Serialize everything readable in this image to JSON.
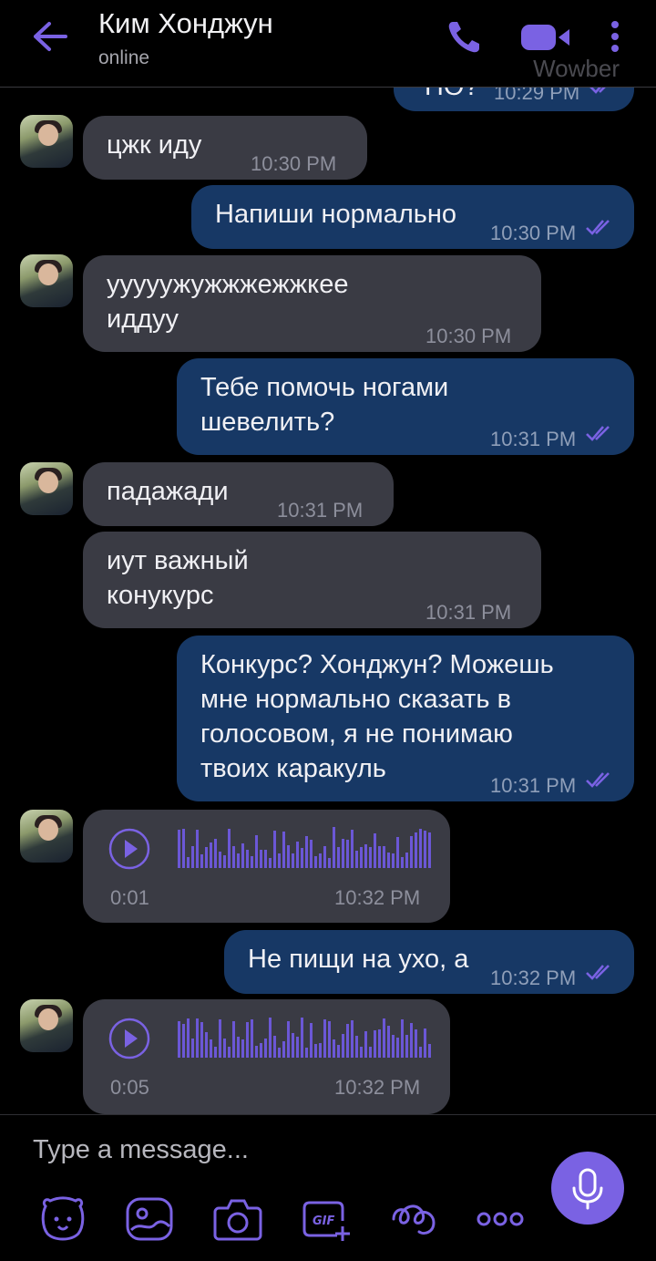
{
  "header": {
    "contact_name": "Ким Хонджун",
    "status": "online",
    "watermark": "Wowber",
    "icons": [
      "back-arrow-icon",
      "phone-icon",
      "video-camera-icon",
      "more-vert-icon"
    ]
  },
  "messages": [
    {
      "direction": "out",
      "text": "ПО?",
      "time": "10:29 PM",
      "read": true,
      "cut_off": true
    },
    {
      "direction": "in",
      "text": "цжк иду",
      "time": "10:30 PM"
    },
    {
      "direction": "out",
      "text": "Напиши нормально",
      "time": "10:30 PM",
      "read": true
    },
    {
      "direction": "in",
      "text": "ууууужужжжежжкее\nиддуу",
      "time": "10:30 PM"
    },
    {
      "direction": "out",
      "text": "Тебе помочь ногами\nшевелить?",
      "time": "10:31 PM",
      "read": true
    },
    {
      "direction": "in",
      "text": "падажади",
      "time": "10:31 PM"
    },
    {
      "direction": "in",
      "text": "иут важный\nконукурс",
      "time": "10:31 PM"
    },
    {
      "direction": "out",
      "text": "Конкурс? Хонджун? Можешь\nмне нормально сказать в\nголосовом, я не понимаю\nтвоих каракуль",
      "time": "10:31 PM",
      "read": true
    },
    {
      "direction": "in",
      "type": "voice",
      "duration": "0:01",
      "time": "10:32 PM"
    },
    {
      "direction": "out",
      "text": "Не пищи на ухо, а",
      "time": "10:32 PM",
      "read": true
    },
    {
      "direction": "in",
      "type": "voice",
      "duration": "0:05",
      "time": "10:32 PM"
    }
  ],
  "composer": {
    "placeholder": "Type a message...",
    "icons": [
      "sticker-bear-icon",
      "gallery-icon",
      "camera-icon",
      "gif-icon",
      "doodle-icon",
      "more-horiz-icon"
    ],
    "mic_icon": "microphone-icon"
  },
  "colors": {
    "background": "#000000",
    "incoming_bubble": "#3a3b44",
    "outgoing_bubble": "#173865",
    "accent": "#7a62e3"
  }
}
